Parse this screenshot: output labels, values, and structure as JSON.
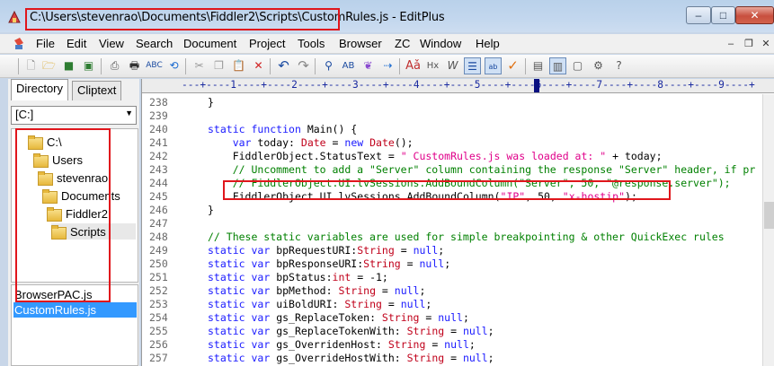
{
  "window": {
    "path": "C:\\Users\\stevenrao\\Documents\\Fiddler2\\Scripts\\CustomRules.js",
    "app": " - EditPlus",
    "min": "–",
    "max": "□",
    "close": "✕"
  },
  "menu": [
    "File",
    "Edit",
    "View",
    "Search",
    "Document",
    "Project",
    "Tools",
    "Browser",
    "ZC",
    "Window",
    "Help"
  ],
  "mdi": {
    "min": "–",
    "restore": "❐",
    "close": "✕"
  },
  "sidebar": {
    "tabs": [
      "Directory",
      "Cliptext"
    ],
    "drive": "[C:]",
    "tree": [
      "C:\\",
      "Users",
      "stevenrao",
      "Documents",
      "Fiddler2",
      "Scripts"
    ],
    "files": [
      "BrowserPAC.js",
      "CustomRules.js"
    ]
  },
  "ruler": "---+----1----+----2----+----3----+----4----+----5----+----6----+----7----+----8----+----9----+",
  "editor": {
    "lines": [
      {
        "n": "238",
        "t": "}"
      },
      {
        "n": "239",
        "t": ""
      },
      {
        "n": "240",
        "t": "static function Main() {"
      },
      {
        "n": "241",
        "t": "    var today: Date = new Date();"
      },
      {
        "n": "242",
        "t": "    FiddlerObject.StatusText = \" CustomRules.js was loaded at: \" + today;"
      },
      {
        "n": "243",
        "t": "    // Uncomment to add a \"Server\" column containing the response \"Server\" header, if pr"
      },
      {
        "n": "244",
        "t": "    // FiddlerObject.UI.lvSessions.AddBoundColumn(\"Server\", 50, \"@response.server\");"
      },
      {
        "n": "245",
        "t": "    FiddlerObject.UI.lvSessions.AddBoundColumn(\"IP\", 50, \"x-hostip\");"
      },
      {
        "n": "246",
        "t": "}"
      },
      {
        "n": "247",
        "t": ""
      },
      {
        "n": "248",
        "t": "// These static variables are used for simple breakpointing & other QuickExec rules"
      },
      {
        "n": "249",
        "t": "static var bpRequestURI:String = null;"
      },
      {
        "n": "250",
        "t": "static var bpResponseURI:String = null;"
      },
      {
        "n": "251",
        "t": "static var bpStatus:int = -1;"
      },
      {
        "n": "252",
        "t": "static var bpMethod: String = null;"
      },
      {
        "n": "253",
        "t": "static var uiBoldURI: String = null;"
      },
      {
        "n": "254",
        "t": "static var gs_ReplaceToken: String = null;"
      },
      {
        "n": "255",
        "t": "static var gs_ReplaceTokenWith: String = null;"
      },
      {
        "n": "256",
        "t": "static var gs_OverridenHost: String = null;"
      },
      {
        "n": "257",
        "t": "static var gs_OverrideHostWith: String = null;"
      }
    ]
  },
  "colors": {
    "keyword": "#1a1aff",
    "type": "#c0001a",
    "string": "#e0008a",
    "comment": "#008000",
    "annotation": "#e0161c",
    "selection": "#3399ff"
  }
}
